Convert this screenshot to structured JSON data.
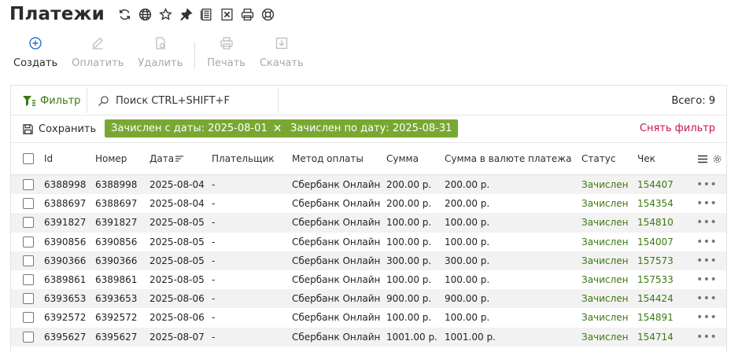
{
  "page": {
    "title": "Платежи",
    "title_icons": [
      "refresh-icon",
      "globe-icon",
      "star-icon",
      "pin-icon",
      "excel-doc-icon",
      "excel-icon",
      "print-icon",
      "help-icon"
    ]
  },
  "toolbar": {
    "create": "Создать",
    "pay": "Оплатить",
    "delete": "Удалить",
    "print": "Печать",
    "download": "Скачать"
  },
  "search": {
    "filter_label": "Фильтр",
    "placeholder": "Поиск CTRL+SHIFT+F",
    "total": "Всего: 9"
  },
  "filters": {
    "save_label": "Сохранить",
    "chip_from": "Зачислен с даты: 2025-08-01",
    "chip_to": "Зачислен по дату: 2025-08-31",
    "clear_label": "Снять фильтр"
  },
  "colors": {
    "accent_green": "#78a832",
    "status_green": "#3b7a10",
    "clear_red": "#c3184e"
  },
  "table": {
    "columns": [
      "Id",
      "Номер",
      "Дата",
      "Плательщик",
      "Метод оплаты",
      "Сумма",
      "Сумма в валюте платежа",
      "Статус",
      "Чек"
    ],
    "rows": [
      {
        "id": "6388998",
        "number": "6388998",
        "date": "2025-08-04",
        "payer": "-",
        "method": "Сбербанк Онлайн",
        "sum": "200.00 р.",
        "sum_cur": "200.00 р.",
        "status": "Зачислен",
        "check": "154407"
      },
      {
        "id": "6388697",
        "number": "6388697",
        "date": "2025-08-04",
        "payer": "-",
        "method": "Сбербанк Онлайн",
        "sum": "200.00 р.",
        "sum_cur": "200.00 р.",
        "status": "Зачислен",
        "check": "154354"
      },
      {
        "id": "6391827",
        "number": "6391827",
        "date": "2025-08-05",
        "payer": "-",
        "method": "Сбербанк Онлайн",
        "sum": "100.00 р.",
        "sum_cur": "100.00 р.",
        "status": "Зачислен",
        "check": "154810"
      },
      {
        "id": "6390856",
        "number": "6390856",
        "date": "2025-08-05",
        "payer": "-",
        "method": "Сбербанк Онлайн",
        "sum": "100.00 р.",
        "sum_cur": "100.00 р.",
        "status": "Зачислен",
        "check": "154007"
      },
      {
        "id": "6390366",
        "number": "6390366",
        "date": "2025-08-05",
        "payer": "-",
        "method": "Сбербанк Онлайн",
        "sum": "300.00 р.",
        "sum_cur": "300.00 р.",
        "status": "Зачислен",
        "check": "157573"
      },
      {
        "id": "6389861",
        "number": "6389861",
        "date": "2025-08-05",
        "payer": "-",
        "method": "Сбербанк Онлайн",
        "sum": "100.00 р.",
        "sum_cur": "100.00 р.",
        "status": "Зачислен",
        "check": "157533"
      },
      {
        "id": "6393653",
        "number": "6393653",
        "date": "2025-08-06",
        "payer": "-",
        "method": "Сбербанк Онлайн",
        "sum": "900.00 р.",
        "sum_cur": "900.00 р.",
        "status": "Зачислен",
        "check": "154424"
      },
      {
        "id": "6392572",
        "number": "6392572",
        "date": "2025-08-06",
        "payer": "-",
        "method": "Сбербанк Онлайн",
        "sum": "100.00 р.",
        "sum_cur": "100.00 р.",
        "status": "Зачислен",
        "check": "154891"
      },
      {
        "id": "6395627",
        "number": "6395627",
        "date": "2025-08-07",
        "payer": "-",
        "method": "Сбербанк Онлайн",
        "sum": "1001.00 р.",
        "sum_cur": "1001.00 р.",
        "status": "Зачислен",
        "check": "154714"
      }
    ],
    "row_menu": "•••"
  }
}
